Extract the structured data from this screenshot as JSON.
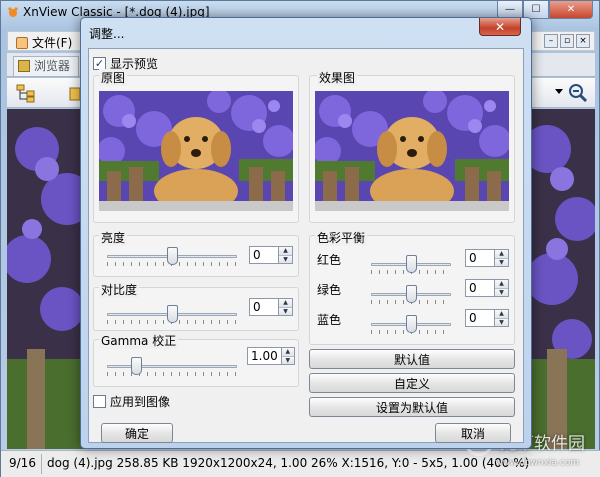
{
  "main_window": {
    "title": "XnView Classic - [*.dog (4).jpg]",
    "caption": {
      "minimize": "—",
      "maximize": "☐",
      "close": "✕"
    },
    "menu": {
      "file_label": "文件(F)"
    },
    "mdi": {
      "minimize": "–",
      "restore": "▫",
      "close": "×"
    },
    "tab_label": "浏览器",
    "icons": {
      "browser": "browser-tree-icon",
      "zoom": "zoom-icon"
    },
    "status": {
      "index": "9/16",
      "info": "dog (4).jpg   258.85 KB   1920x1200x24, 1.00   26%   X:1516, Y:0 - 5x5, 1.00 (400 %)"
    }
  },
  "dialog": {
    "title": "调整...",
    "close_label": "✕",
    "show_preview_label": "显示预览",
    "show_preview_checked": true,
    "original_label": "原图",
    "result_label": "效果图",
    "brightness": {
      "label": "亮度",
      "value": "0",
      "level": 0.5
    },
    "contrast": {
      "label": "对比度",
      "value": "0",
      "level": 0.5
    },
    "gamma": {
      "label": "Gamma 校正",
      "value": "1.00",
      "level": 0.2
    },
    "apply_to_image_label": "应用到图像",
    "apply_to_image_checked": false,
    "color_balance": {
      "label": "色彩平衡",
      "red": {
        "label": "红色",
        "value": "0",
        "level": 0.5
      },
      "green": {
        "label": "绿色",
        "value": "0",
        "level": 0.5
      },
      "blue": {
        "label": "蓝色",
        "value": "0",
        "level": 0.5
      }
    },
    "buttons": {
      "default": "默认值",
      "custom": "自定义",
      "set_default": "设置为默认值",
      "ok": "确定",
      "cancel": "取消"
    }
  },
  "watermark": {
    "text": "光下软件园",
    "sub": "www.downxia.com"
  },
  "colors": {
    "dialog_frame": "#bcd2ec",
    "close_red": "#c2412a",
    "client_bg": "#f0f0f0"
  }
}
